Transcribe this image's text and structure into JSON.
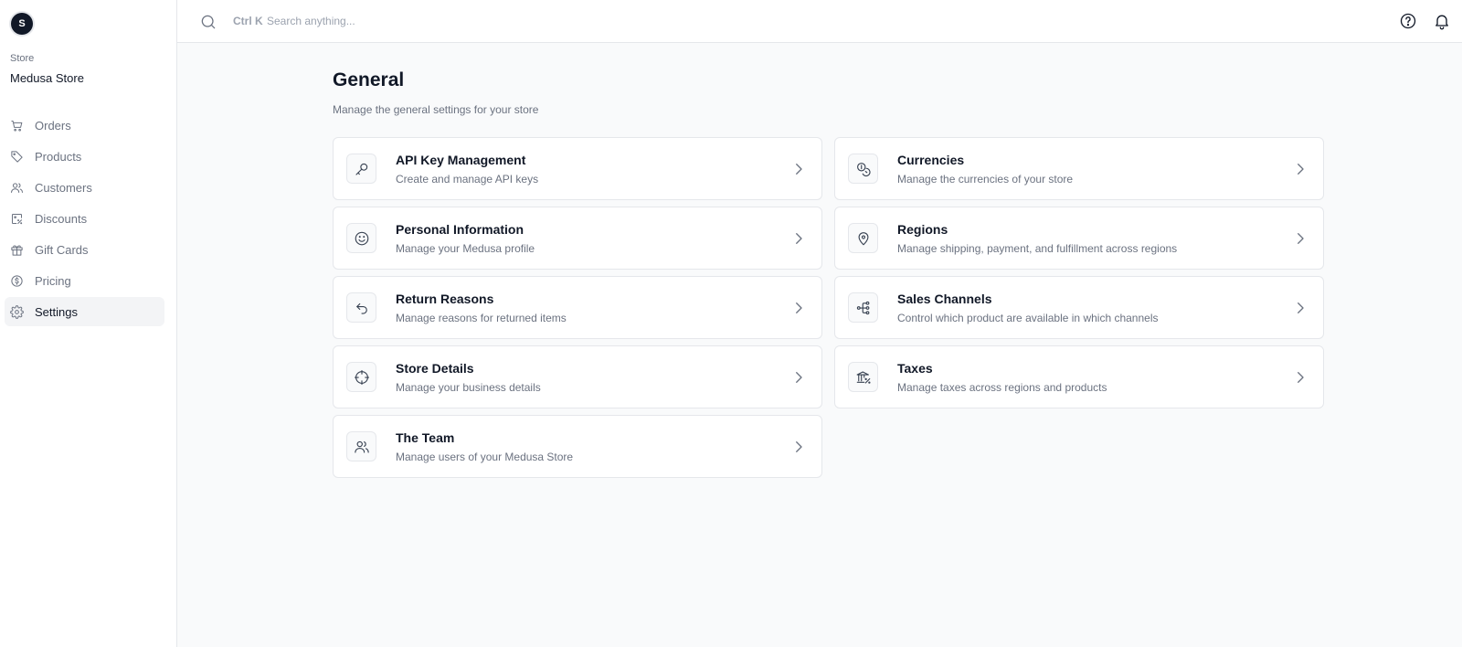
{
  "store": {
    "avatar_letter": "S",
    "label": "Store",
    "name": "Medusa Store"
  },
  "nav": [
    {
      "label": "Orders",
      "icon": "cart-icon",
      "active": false
    },
    {
      "label": "Products",
      "icon": "tag-icon",
      "active": false
    },
    {
      "label": "Customers",
      "icon": "users-icon",
      "active": false
    },
    {
      "label": "Discounts",
      "icon": "discount-icon",
      "active": false
    },
    {
      "label": "Gift Cards",
      "icon": "gift-icon",
      "active": false
    },
    {
      "label": "Pricing",
      "icon": "dollar-circle-icon",
      "active": false
    },
    {
      "label": "Settings",
      "icon": "gear-icon",
      "active": true
    }
  ],
  "search": {
    "shortcut": "Ctrl K",
    "placeholder": "Search anything..."
  },
  "page": {
    "title": "General",
    "subtitle": "Manage the general settings for your store"
  },
  "cards": [
    {
      "title": "API Key Management",
      "description": "Create and manage API keys",
      "icon": "key-icon"
    },
    {
      "title": "Currencies",
      "description": "Manage the currencies of your store",
      "icon": "coins-icon"
    },
    {
      "title": "Personal Information",
      "description": "Manage your Medusa profile",
      "icon": "smile-icon"
    },
    {
      "title": "Regions",
      "description": "Manage shipping, payment, and fulfillment across regions",
      "icon": "map-pin-icon"
    },
    {
      "title": "Return Reasons",
      "description": "Manage reasons for returned items",
      "icon": "return-arrow-icon"
    },
    {
      "title": "Sales Channels",
      "description": "Control which product are available in which channels",
      "icon": "channels-icon"
    },
    {
      "title": "Store Details",
      "description": "Manage your business details",
      "icon": "crosshair-icon"
    },
    {
      "title": "Taxes",
      "description": "Manage taxes across regions and products",
      "icon": "tax-building-icon"
    },
    {
      "title": "The Team",
      "description": "Manage users of your Medusa Store",
      "icon": "users-icon"
    }
  ],
  "colors": {
    "accent_bg": "#f3f4f6",
    "text_primary": "#111827",
    "text_muted": "#6b7280",
    "border": "#e5e7eb"
  }
}
